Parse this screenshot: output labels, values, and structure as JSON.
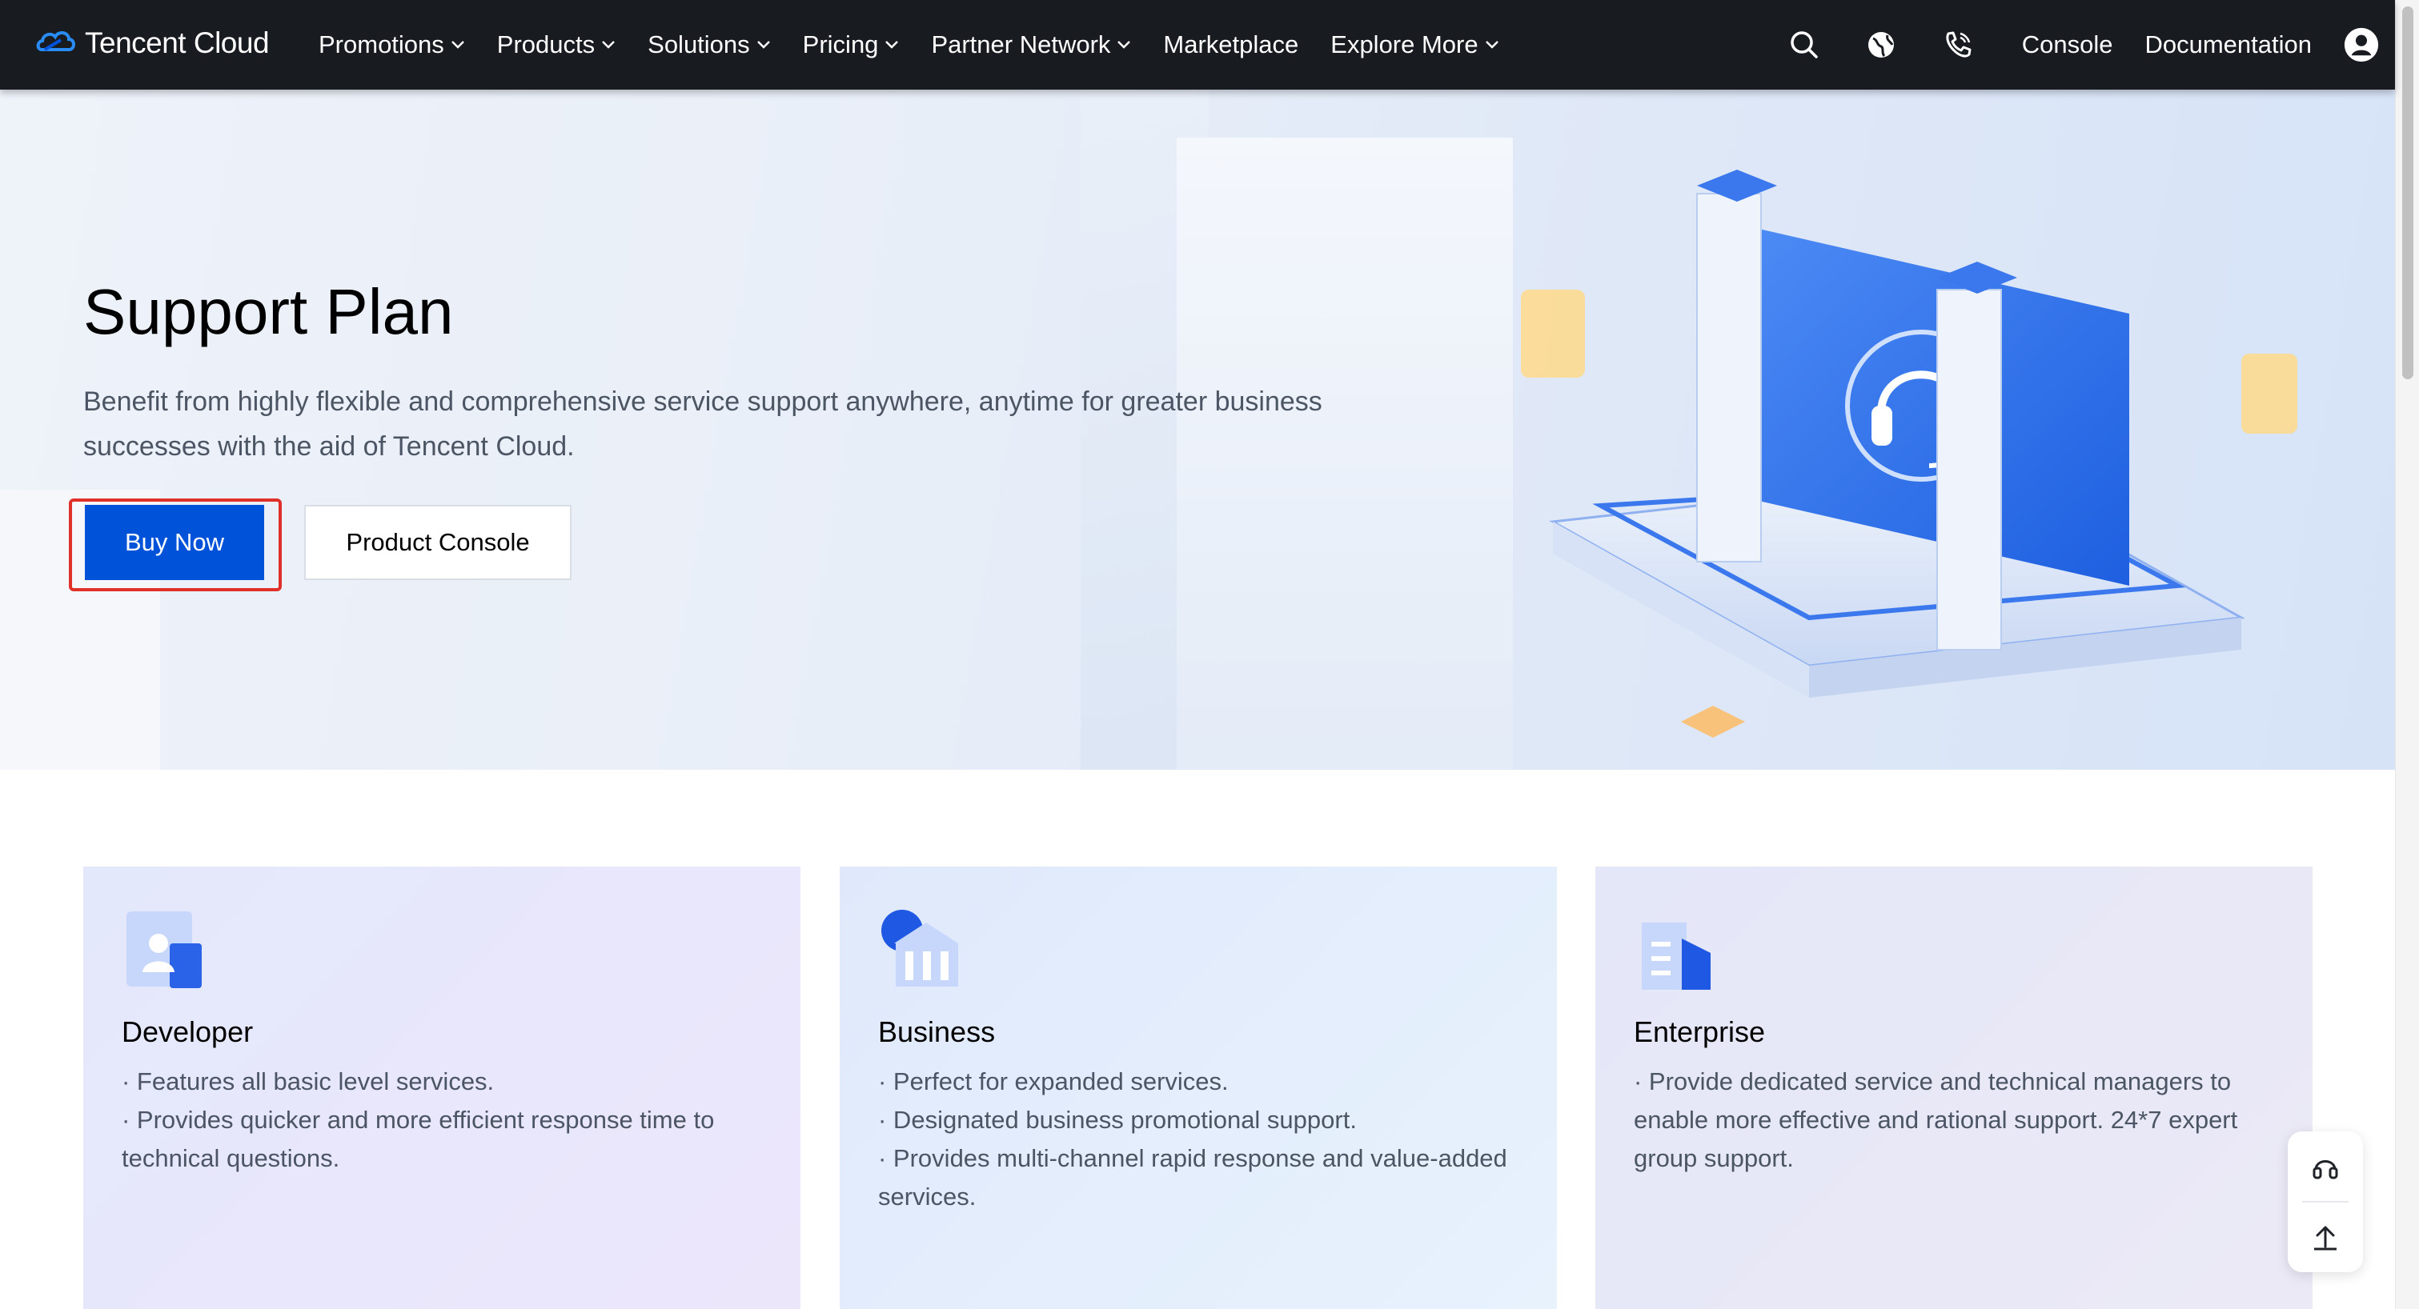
{
  "nav": {
    "brand": "Tencent Cloud",
    "links": [
      {
        "label": "Promotions",
        "has_dropdown": true
      },
      {
        "label": "Products",
        "has_dropdown": true
      },
      {
        "label": "Solutions",
        "has_dropdown": true
      },
      {
        "label": "Pricing",
        "has_dropdown": true
      },
      {
        "label": "Partner Network",
        "has_dropdown": true
      },
      {
        "label": "Marketplace",
        "has_dropdown": false
      },
      {
        "label": "Explore More",
        "has_dropdown": true
      }
    ],
    "icons": [
      "search-icon",
      "globe-icon",
      "phone-icon"
    ],
    "console": "Console",
    "documentation": "Documentation",
    "user_icon": "user-icon"
  },
  "hero": {
    "title": "Support Plan",
    "description": "Benefit from highly flexible and comprehensive service support anywhere, anytime for greater business successes with the aid of Tencent Cloud.",
    "buy_now": "Buy Now",
    "product_console": "Product Console"
  },
  "plans": [
    {
      "title": "Developer",
      "icon": "developer-icon",
      "features": [
        "· Features all basic level services.",
        "· Provides quicker and more efficient response time to technical questions."
      ]
    },
    {
      "title": "Business",
      "icon": "business-icon",
      "features": [
        "· Perfect for expanded services.",
        "· Designated business promotional support.",
        "· Provides multi-channel rapid response and value-added services."
      ]
    },
    {
      "title": "Enterprise",
      "icon": "enterprise-icon",
      "features": [
        "· Provide dedicated service and technical managers to enable more effective and rational support. 24*7 expert group support."
      ]
    }
  ],
  "colors": {
    "nav_bg": "#181c21",
    "primary": "#0052d9",
    "highlight": "#e0302a"
  }
}
